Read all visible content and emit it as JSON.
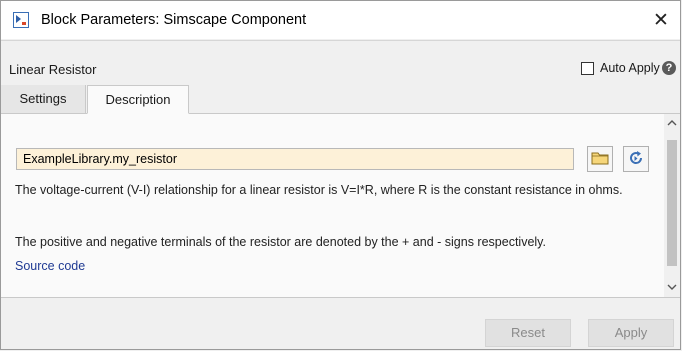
{
  "window": {
    "title": "Block Parameters: Simscape Component",
    "close_glyph": "✕"
  },
  "block": {
    "name": "Linear Resistor",
    "auto_apply_label": "Auto Apply",
    "auto_apply_checked": false,
    "help_glyph": "?"
  },
  "tabs": [
    {
      "label": "Settings",
      "selected": false
    },
    {
      "label": "Description",
      "selected": true
    }
  ],
  "description": {
    "source_field_value": "ExampleLibrary.my_resistor",
    "paragraph_1": "The voltage-current (V-I) relationship for a linear resistor is V=I*R, where R is the constant resistance in ohms.",
    "paragraph_2": "The positive and negative terminals of the resistor are denoted by the + and - signs respectively.",
    "source_link": "Source code"
  },
  "buttons": {
    "reset": "Reset",
    "apply": "Apply",
    "enabled": false
  },
  "icons": {
    "app": "simulink-block-icon",
    "folder": "folder-icon",
    "refresh": "refresh-icon",
    "help": "help-icon"
  },
  "colors": {
    "source_field_bg": "#fdf1d8",
    "link": "#1f3a93"
  }
}
